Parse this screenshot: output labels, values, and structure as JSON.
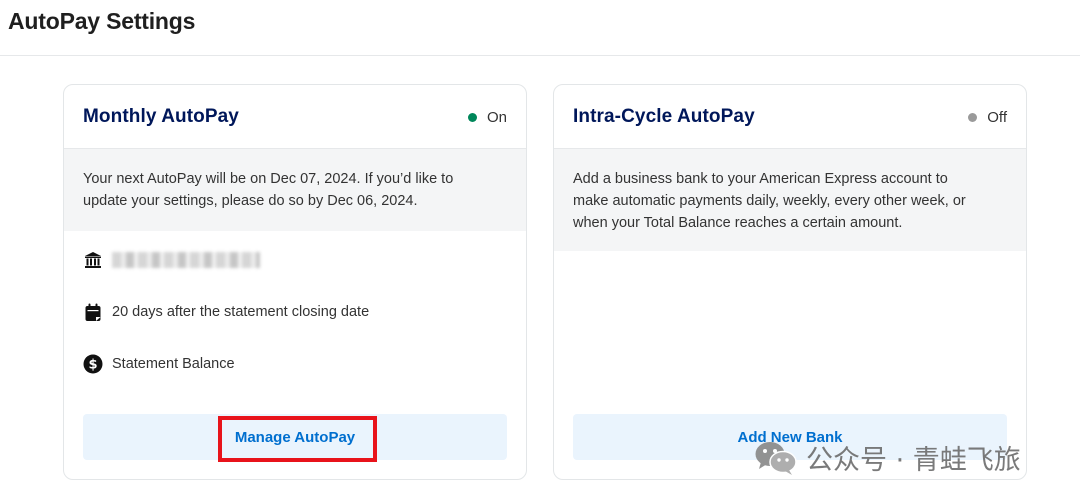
{
  "page": {
    "title": "AutoPay Settings"
  },
  "monthly": {
    "title": "Monthly AutoPay",
    "status": "On",
    "notice": "Your next AutoPay will be on Dec 07, 2024. If you’d like to update your settings, please do so by Dec 06, 2024.",
    "details": [
      {
        "icon": "bank-icon",
        "text": ""
      },
      {
        "icon": "calendar-icon",
        "text": "20 days after the statement closing date"
      },
      {
        "icon": "dollar-icon",
        "text": "Statement Balance"
      }
    ],
    "button_label": "Manage AutoPay"
  },
  "intra_cycle": {
    "title": "Intra-Cycle AutoPay",
    "status": "Off",
    "notice": "Add a business bank to your American Express account to make automatic payments daily, weekly, every other week, or when your Total Balance reaches a certain amount.",
    "button_label": "Add New Bank"
  },
  "watermark": {
    "text": "公众号 · 青蛙飞旅",
    "icon": "wechat-icon"
  },
  "colors": {
    "title_navy": "#00175a",
    "status_on": "#00875a",
    "status_off": "#9a9a9a",
    "button_text": "#006fcf",
    "button_bg": "#eaf4fd",
    "highlight": "#e8131b"
  }
}
